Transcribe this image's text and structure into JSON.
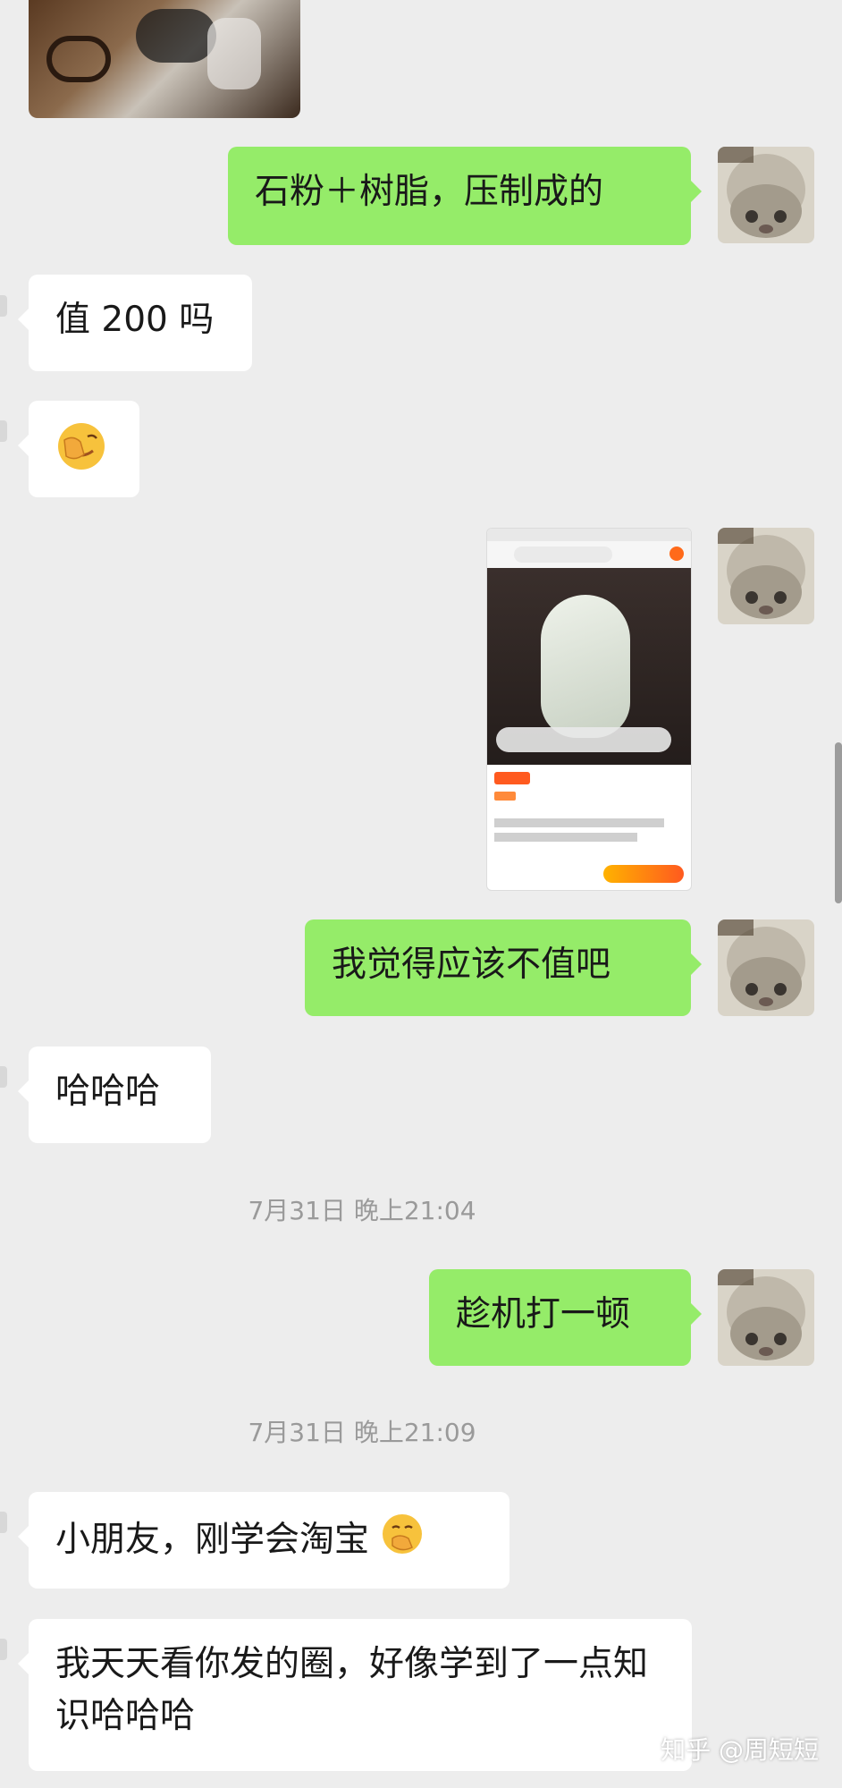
{
  "messages": {
    "m1": "石粉＋树脂，压制成的",
    "m2": "值 200 吗",
    "m3_emoji": "facepalm-emoji",
    "m5": "我觉得应该不值吧",
    "m6": "哈哈哈",
    "m8": "趁机打一顿",
    "m10": "小朋友，刚学会淘宝",
    "m11": "我天天看你发的圈，好像学到了一点知识哈哈哈"
  },
  "timestamps": {
    "t1": "7月31日 晚上21:04",
    "t2": "7月31日 晚上21:09"
  },
  "watermark": "知乎 @周短短",
  "colors": {
    "background": "#ededed",
    "outgoing_bubble": "#95ec69",
    "incoming_bubble": "#ffffff",
    "timestamp": "#9a9a9a"
  },
  "icons": [
    "avatar",
    "image-thumbnail",
    "facepalm-emoji",
    "hand-over-mouth-emoji"
  ]
}
